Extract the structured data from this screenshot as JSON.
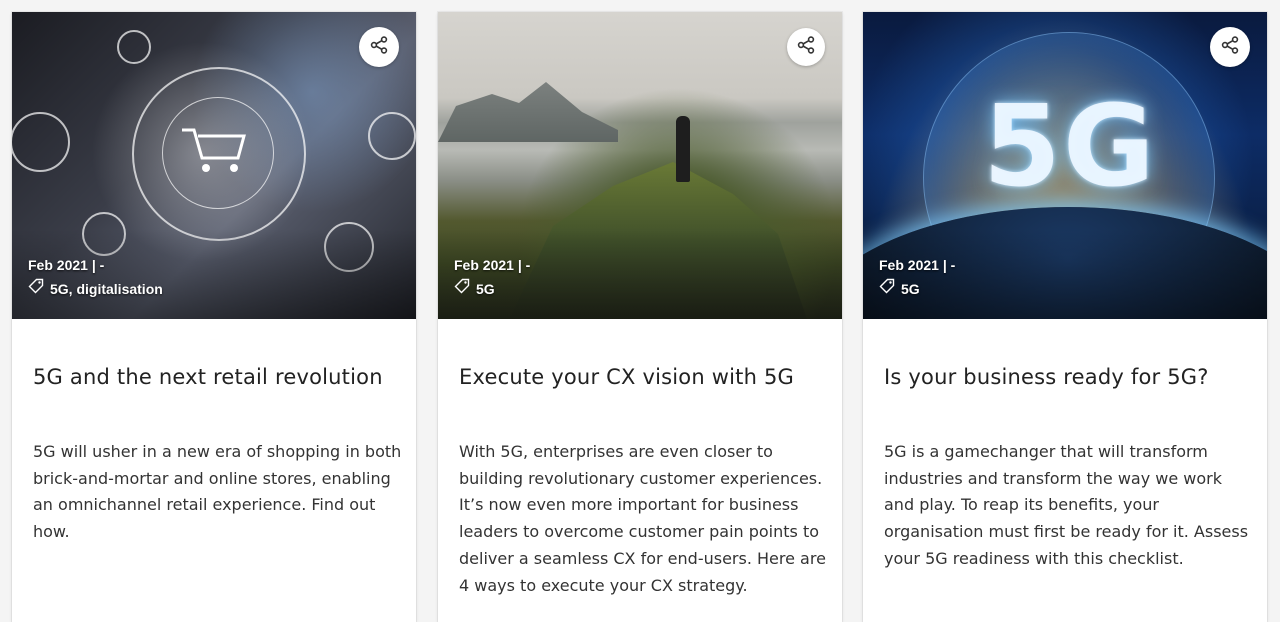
{
  "cards": [
    {
      "date": "Feb 2021 | -",
      "tags": "5G, digitalisation",
      "title": "5G and the next retail revolution",
      "description": "5G will usher in a new era of shopping in both brick-and-mortar and online stores, enabling an omnichannel retail experience. Find out how."
    },
    {
      "date": "Feb 2021 | -",
      "tags": "5G",
      "title": "Execute your CX vision with 5G",
      "description": "With 5G, enterprises are even closer to building revolutionary customer experiences. It’s now even more important for business leaders to overcome customer pain points to deliver a seamless CX for end-users. Here are 4 ways to execute your CX strategy."
    },
    {
      "date": "Feb 2021 | -",
      "tags": "5G",
      "title": "Is your business ready for 5G?",
      "description": "5G is a gamechanger that will transform industries and transform the way we work and play. To reap its benefits, your organisation must first be ready for it. Assess your 5G readiness with this checklist.",
      "image_text": "5G"
    }
  ],
  "icons": {
    "share": "share-icon",
    "tag": "tag-icon"
  }
}
